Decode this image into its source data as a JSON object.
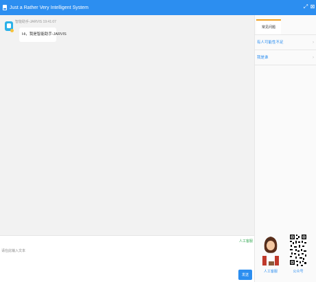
{
  "window": {
    "title": "Just a Rather Very Intelligent System"
  },
  "chat": {
    "messages": [
      {
        "sender": "智能助手-JARVIS",
        "time": "19:41:07",
        "text": "Hi，我是智能助手-JARVIS"
      }
    ]
  },
  "input": {
    "human_service_link": "人工客服",
    "placeholder": "请在此输入文本",
    "send_label": "发送"
  },
  "sidebar": {
    "tab_label": "常见问题",
    "faq": [
      {
        "label": "有人可能性不足"
      },
      {
        "label": "我是谁"
      }
    ],
    "human_service_label": "人工客服",
    "qr_label": "公众号"
  },
  "colors": {
    "primary": "#2c8ef0",
    "tab_accent": "#f0a020",
    "human_link": "#34a853"
  }
}
